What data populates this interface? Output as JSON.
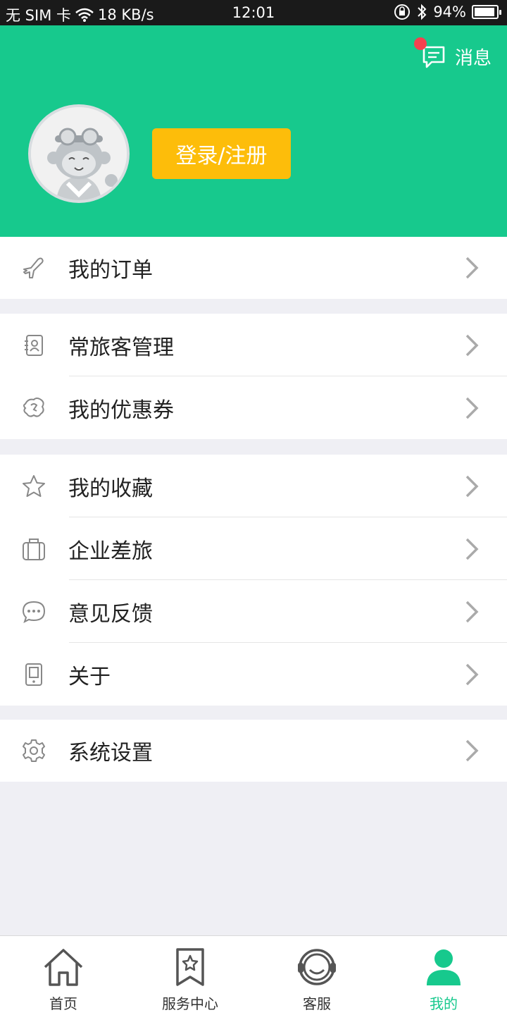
{
  "status_bar": {
    "carrier": "无 SIM 卡",
    "speed": "18 KB/s",
    "time": "12:01",
    "battery": "94%",
    "battery_level": 0.94
  },
  "header": {
    "messages_label": "消息",
    "login_label": "登录/注册",
    "has_unread": true,
    "bg_color": "#17c98d",
    "button_color": "#fdbd0a"
  },
  "menu": {
    "group1": [
      {
        "label": "我的订单",
        "icon": "airplane-icon"
      }
    ],
    "group2": [
      {
        "label": "常旅客管理",
        "icon": "contact-book-icon"
      },
      {
        "label": "我的优惠券",
        "icon": "coupon-icon"
      }
    ],
    "group3": [
      {
        "label": "我的收藏",
        "icon": "star-icon"
      },
      {
        "label": "企业差旅",
        "icon": "briefcase-icon"
      },
      {
        "label": "意见反馈",
        "icon": "chat-icon"
      },
      {
        "label": "关于",
        "icon": "device-icon"
      }
    ],
    "group4": [
      {
        "label": "系统设置",
        "icon": "gear-icon"
      }
    ]
  },
  "bottom_nav": [
    {
      "label": "首页",
      "icon": "home-icon",
      "active": false
    },
    {
      "label": "服务中心",
      "icon": "bookmark-star-icon",
      "active": false
    },
    {
      "label": "客服",
      "icon": "headset-icon",
      "active": false
    },
    {
      "label": "我的",
      "icon": "user-icon",
      "active": true
    }
  ]
}
